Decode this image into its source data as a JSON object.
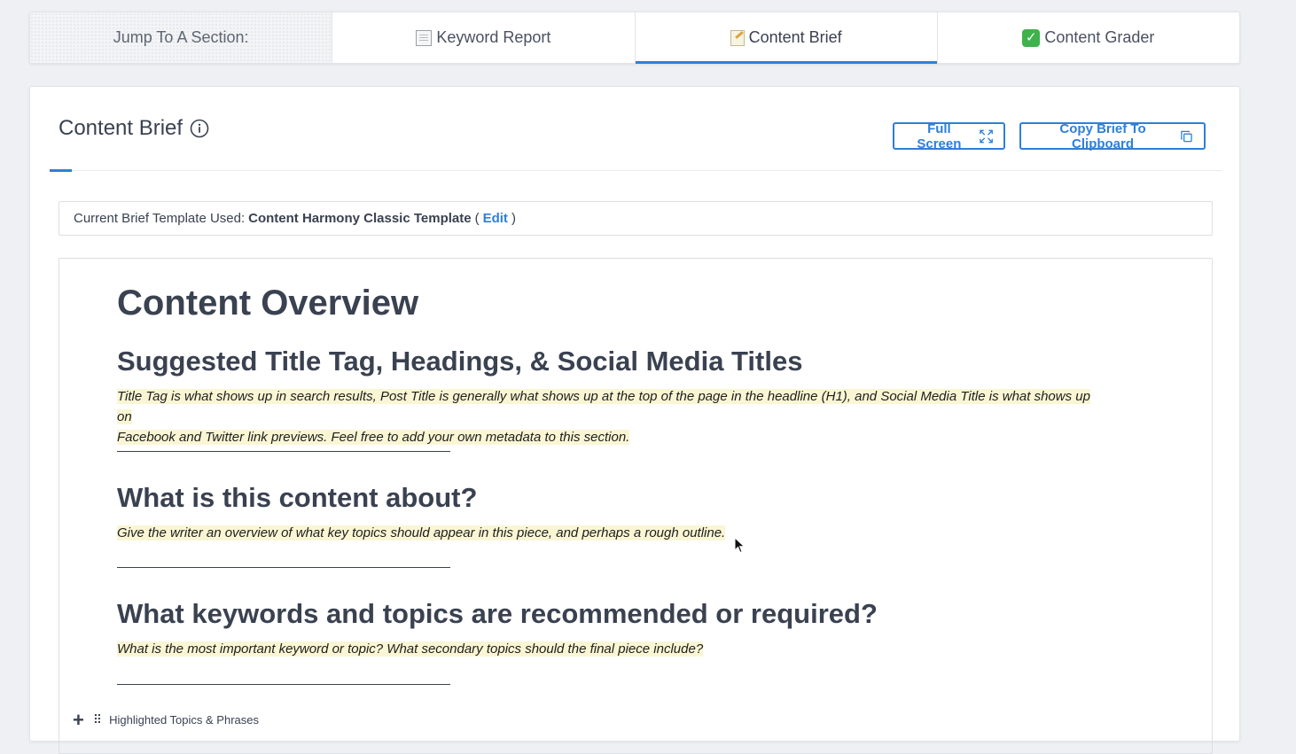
{
  "jump_nav": {
    "label": "Jump To A Section:",
    "items": [
      {
        "label": "Keyword Report",
        "icon": "report-icon"
      },
      {
        "label": "Content Brief",
        "icon": "memo-icon",
        "active": true
      },
      {
        "label": "Content Grader",
        "icon": "check-icon"
      }
    ]
  },
  "brief": {
    "title": "Content Brief",
    "full_screen_label": "Full Screen",
    "copy_label": "Copy Brief To Clipboard",
    "template": {
      "prefix": "Current Brief Template Used:",
      "name": "Content Harmony Classic Template",
      "open": "(",
      "edit": "Edit",
      "close": ")"
    }
  },
  "editor": {
    "h1": "Content Overview",
    "sections": [
      {
        "heading": "Suggested Title Tag, Headings, & Social Media Titles",
        "hint_line1": "Title Tag is what shows up in search results, Post Title is generally what shows up at the top of the page in the headline (H1), and Social Media Title is what shows up on",
        "hint_line2": "Facebook and Twitter link previews. Feel free to add your own metadata to this section."
      },
      {
        "heading": "What is this content about?",
        "hint": "Give the writer an overview of what key topics should appear in this piece, and perhaps a rough outline."
      },
      {
        "heading": "What keywords and topics are recommended or required?",
        "hint": "What is the most important keyword or topic? What secondary topics should the final piece include?"
      }
    ],
    "next_block_label": "Highlighted Topics & Phrases"
  },
  "colors": {
    "accent": "#2f7fd8",
    "hint_highlight": "#faf6d4",
    "text": "#3a4150"
  }
}
